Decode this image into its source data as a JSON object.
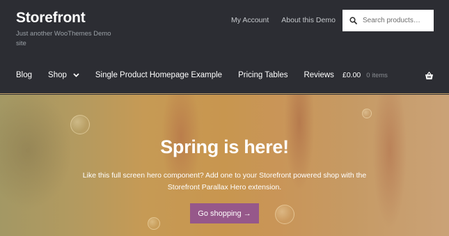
{
  "site": {
    "title": "Storefront",
    "tagline": "Just another WooThemes Demo site"
  },
  "secondary_nav": [
    {
      "label": "My Account"
    },
    {
      "label": "About this Demo"
    }
  ],
  "search": {
    "placeholder": "Search products…",
    "icon": "search-icon"
  },
  "primary_nav": [
    {
      "label": "Blog"
    },
    {
      "label": "Shop",
      "has_dropdown": true
    },
    {
      "label": "Single Product Homepage Example"
    },
    {
      "label": "Pricing Tables"
    },
    {
      "label": "Reviews"
    }
  ],
  "cart": {
    "amount": "£0.00",
    "count": "0 items",
    "icon": "basket-icon"
  },
  "hero": {
    "title": "Spring is here!",
    "text": "Like this full screen hero component? Add one to your Storefront powered shop with the Storefront Parallax Hero extension.",
    "button_label": "Go shopping →"
  },
  "colors": {
    "header_bg": "#2c2d33",
    "accent_button": "#96588a",
    "header_border": "#c7a46a"
  }
}
